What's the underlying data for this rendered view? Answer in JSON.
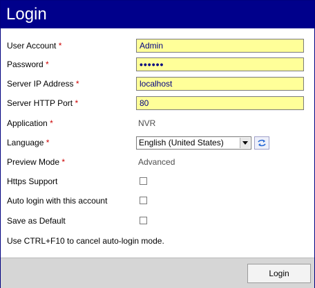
{
  "dialog": {
    "title": "Login"
  },
  "fields": {
    "user_account": {
      "label": "User Account",
      "value": "Admin",
      "required_mark": "*"
    },
    "password": {
      "label": "Password",
      "value": "••••••",
      "required_mark": "*"
    },
    "server_ip": {
      "label": "Server IP Address",
      "value": "localhost",
      "required_mark": "*"
    },
    "server_port": {
      "label": "Server HTTP Port",
      "value": "80",
      "required_mark": "*"
    },
    "application": {
      "label": "Application",
      "value": "NVR",
      "required_mark": "*"
    },
    "language": {
      "label": "Language",
      "value": "English (United States)",
      "required_mark": "*",
      "refresh_icon": "refresh-icon"
    },
    "preview_mode": {
      "label": "Preview Mode",
      "value": "Advanced",
      "required_mark": "*"
    },
    "https_support": {
      "label": "Https Support",
      "checked": false
    },
    "auto_login": {
      "label": "Auto login with this account",
      "checked": false
    },
    "save_default": {
      "label": "Save as Default",
      "checked": false
    }
  },
  "note": "Use CTRL+F10 to cancel auto-login mode.",
  "footer": {
    "login_label": "Login"
  },
  "colors": {
    "title_bar": "#00008b",
    "input_bg": "#ffff99",
    "required": "#cc0000",
    "footer_bg": "#d6d6d6"
  }
}
